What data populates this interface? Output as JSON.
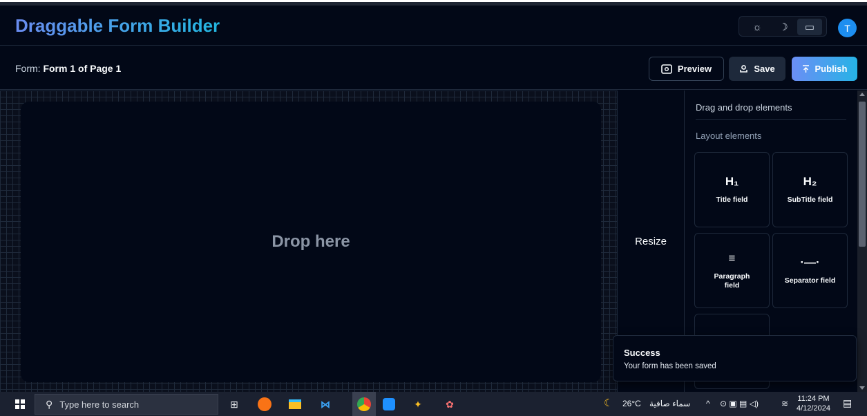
{
  "header": {
    "title": "Draggable Form Builder",
    "theme_options": [
      {
        "icon": "sun-icon",
        "glyph": "☼"
      },
      {
        "icon": "moon-icon",
        "glyph": "☽"
      },
      {
        "icon": "monitor-icon",
        "glyph": "▭"
      }
    ],
    "avatar_initial": "T"
  },
  "formbar": {
    "form_label": "Form:",
    "form_name": "Form 1 of Page 1",
    "preview_label": "Preview",
    "save_label": "Save",
    "publish_label": "Publish"
  },
  "canvas": {
    "drop_text": "Drop here"
  },
  "resize": {
    "label": "Resize"
  },
  "sidebar": {
    "title": "Drag and drop elements",
    "section": "Layout elements",
    "tiles": [
      {
        "icon": "heading1-icon",
        "glyph": "H₁",
        "label": "Title field"
      },
      {
        "icon": "heading2-icon",
        "glyph": "H₂",
        "label": "SubTitle field"
      },
      {
        "icon": "paragraph-icon",
        "glyph": "≡",
        "label": "Paragraph field"
      },
      {
        "icon": "separator-icon",
        "glyph": "·—·",
        "label": "Separator field"
      }
    ]
  },
  "toast": {
    "title": "Success",
    "description": "Your form has been saved"
  },
  "taskbar": {
    "search_placeholder": "Type here to search",
    "weather": "26°C",
    "weather_desc": "سماء صافية",
    "time": "11:24 PM",
    "date": "4/12/2024"
  },
  "colors": {
    "background": "#020817",
    "accent_gradient_start": "#6b8ef5",
    "accent_gradient_end": "#26b3e6",
    "avatar": "#1d8ef0"
  }
}
